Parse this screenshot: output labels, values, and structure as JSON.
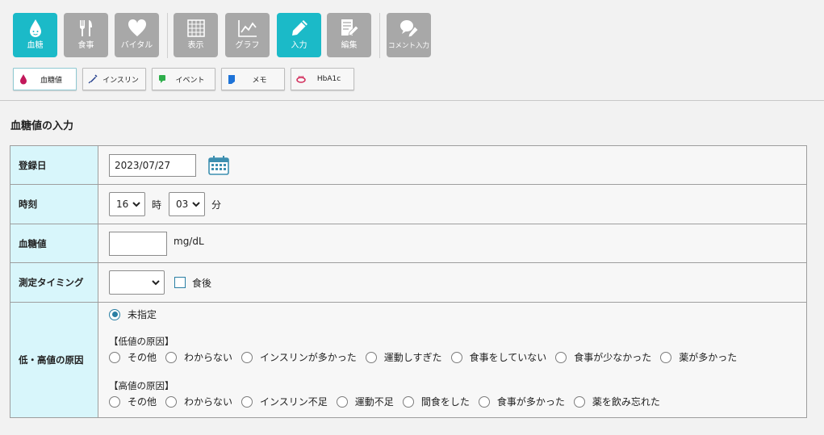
{
  "toolbar": {
    "buttons": [
      {
        "label": "血糖",
        "icon": "drop-icon",
        "active": true
      },
      {
        "label": "食事",
        "icon": "utensils-icon",
        "active": false
      },
      {
        "label": "バイタル",
        "icon": "heart-icon",
        "active": false
      },
      {
        "label": "表示",
        "icon": "grid-icon",
        "active": false
      },
      {
        "label": "グラフ",
        "icon": "chart-icon",
        "active": false
      },
      {
        "label": "入力",
        "icon": "pencil-icon",
        "active": true
      },
      {
        "label": "編集",
        "icon": "edit-doc-icon",
        "active": false
      },
      {
        "label": "コメント入力",
        "icon": "comment-icon",
        "active": false
      }
    ]
  },
  "subtabs": [
    {
      "label": "血糖値",
      "icon": "blood-drop-icon",
      "color": "#c2185b",
      "active": true
    },
    {
      "label": "インスリン",
      "icon": "syringe-icon",
      "color": "#1e3a8a",
      "active": false
    },
    {
      "label": "イベント",
      "icon": "event-flag-icon",
      "color": "#2eae4b",
      "active": false
    },
    {
      "label": "メモ",
      "icon": "memo-icon",
      "color": "#1e73d8",
      "active": false
    },
    {
      "label": "HbA1c",
      "icon": "hba1c-icon",
      "color": "#d22b5a",
      "active": false
    }
  ],
  "section_title": "血糖値の入力",
  "form": {
    "date": {
      "label": "登録日",
      "value": "2023/07/27"
    },
    "time": {
      "label": "時刻",
      "hour": "16",
      "hour_unit": "時",
      "minute": "03",
      "minute_unit": "分"
    },
    "glucose": {
      "label": "血糖値",
      "value": "",
      "unit": "mg/dL"
    },
    "timing": {
      "label": "測定タイミング",
      "value": "",
      "after_meal_label": "食後"
    },
    "cause": {
      "label": "低・高値の原因",
      "unspecified": "未指定",
      "low_title": "【低値の原因】",
      "low_options": [
        "その他",
        "わからない",
        "インスリンが多かった",
        "運動しすぎた",
        "食事をしていない",
        "食事が少なかった",
        "薬が多かった"
      ],
      "high_title": "【高値の原因】",
      "high_options": [
        "その他",
        "わからない",
        "インスリン不足",
        "運動不足",
        "間食をした",
        "食事が多かった",
        "薬を飲み忘れた"
      ]
    }
  },
  "colors": {
    "accent": "#1bbac8",
    "inactive": "#a8a8a8",
    "label_bg": "#d8f6fb"
  }
}
